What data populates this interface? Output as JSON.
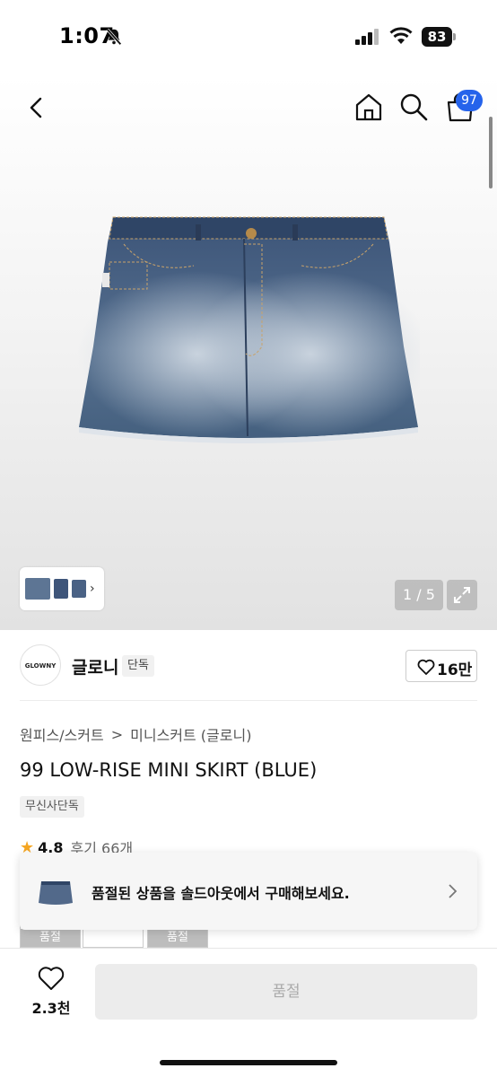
{
  "status_bar": {
    "time": "1:07",
    "battery": "83"
  },
  "nav": {
    "cart_count": "97"
  },
  "gallery": {
    "pager": "1 / 5"
  },
  "brand": {
    "logo_text": "GLOWNY",
    "name": "글로니",
    "badge": "단독",
    "likes": "16만"
  },
  "breadcrumb": {
    "category": "원피스/스커트",
    "separator": ">",
    "subcategory": "미니스커트 (글로니)"
  },
  "product": {
    "title": "99 LOW-RISE MINI SKIRT (BLUE)",
    "tag": "무신사단독",
    "rating": "4.8",
    "reviews": "후기 66개"
  },
  "options": [
    {
      "label": "품절"
    },
    {
      "label": "품절"
    }
  ],
  "soldout_banner": {
    "text": "품절된 상품을 솔드아웃에서 구매해보세요."
  },
  "bottom_bar": {
    "wish_count": "2.3천",
    "buy_label": "품절"
  },
  "colors": {
    "accent": "#2563eb",
    "star": "#f5a623"
  }
}
